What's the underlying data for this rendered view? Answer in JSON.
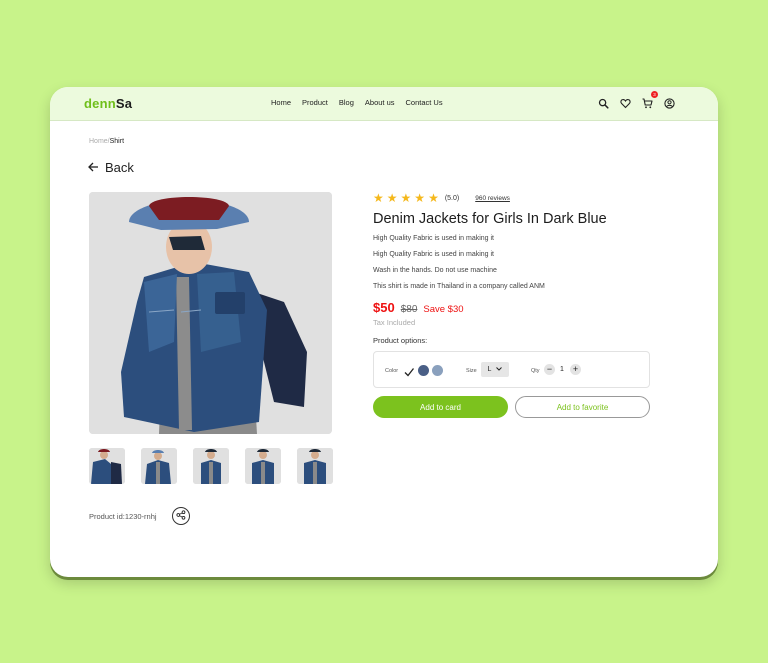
{
  "brand": {
    "logo_part1": "denn",
    "logo_part2": "Sa"
  },
  "nav": {
    "links": [
      "Home",
      "Product",
      "Blog",
      "About us",
      "Contact Us"
    ],
    "cart_count": "3"
  },
  "icons": [
    "search-icon",
    "heart-icon",
    "cart-icon",
    "user-icon",
    "arrow-left-icon",
    "share-icon",
    "star-icon",
    "check-icon",
    "chevron-down-icon"
  ],
  "breadcrumb": {
    "home": "Home/",
    "current": "Shirt"
  },
  "back_label": "Back",
  "product": {
    "rating": 5,
    "rating_text": "(5.0)",
    "reviews": "960 reviews",
    "title": "Denim Jackets for Girls In Dark Blue",
    "description": [
      "High Quality Fabric is used in making it",
      "High Quality Fabric is used in making it",
      "Wash in the hands. Do not use machine",
      "This shirt is made in Thailand in a company called ANM"
    ],
    "price": "$50",
    "old_price": "$80",
    "save": "Save $30",
    "tax": "Tax Included",
    "id": "Product id:1230-rnhj"
  },
  "options": {
    "label": "Product options:",
    "color_label": "Color",
    "colors": [
      "#4a5f86",
      "#8aa0bd"
    ],
    "size_label": "Size",
    "size_value": "L",
    "qty_label": "Qty",
    "qty_value": "1",
    "qty_minus": "−",
    "qty_plus": "+"
  },
  "actions": {
    "add_to_cart": "Add to card",
    "add_to_favorite": "Add to favorite"
  },
  "colors": {
    "accent": "#7cc21e",
    "background": "#c8f38a",
    "nav_bg": "#ecfadd",
    "price": "#e11111",
    "star": "#f5b81c"
  }
}
